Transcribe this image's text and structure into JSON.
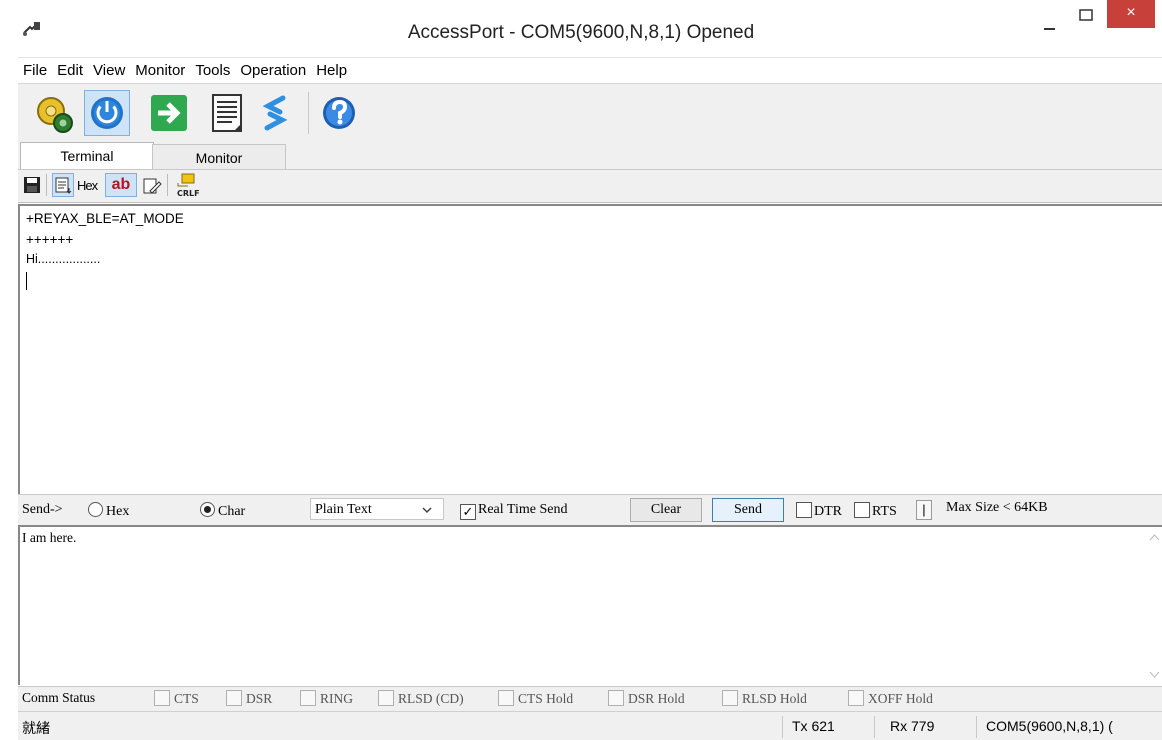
{
  "window": {
    "title": "AccessPort - COM5(9600,N,8,1) Opened",
    "close_glyph": "×"
  },
  "menu": [
    "File",
    "Edit",
    "View",
    "Monitor",
    "Tools",
    "Operation",
    "Help"
  ],
  "toolbar_icons": [
    "settings-gear-icon",
    "power-icon",
    "go-arrow-icon",
    "document-icon",
    "refresh-icon",
    "help-icon"
  ],
  "tabs": {
    "terminal": "Terminal",
    "monitor": "Monitor"
  },
  "subtoolbar": {
    "hex_label": "Hex",
    "ab_label": "ab",
    "crlf_label": "CRLF"
  },
  "terminal": {
    "lines": [
      "+REYAX_BLE=AT_MODE",
      "++++++",
      "Hi.................."
    ]
  },
  "sendbar": {
    "send_label": "Send->",
    "hex_option": "Hex",
    "char_option": "Char",
    "format_value": "Plain Text",
    "realtime_label": "Real Time Send",
    "clear_button": "Clear",
    "send_button": "Send",
    "dtr_label": "DTR",
    "rts_label": "RTS",
    "divider_label": "|",
    "maxsize_label": "Max Size < 64KB",
    "selected_mode": "Char",
    "realtime_checked": true
  },
  "input": {
    "text": "I am here."
  },
  "comm_status": {
    "label": "Comm Status",
    "flags": [
      "CTS",
      "DSR",
      "RING",
      "RLSD (CD)",
      "CTS Hold",
      "DSR Hold",
      "RLSD Hold",
      "XOFF Hold"
    ]
  },
  "statusbar": {
    "ready": "就緒",
    "tx": "Tx 621",
    "rx": "Rx 779",
    "port": "COM5(9600,N,8,1) ("
  },
  "colors": {
    "close_button": "#c7403a",
    "accent_blue": "#1f74c9",
    "green": "#2fa84f"
  }
}
